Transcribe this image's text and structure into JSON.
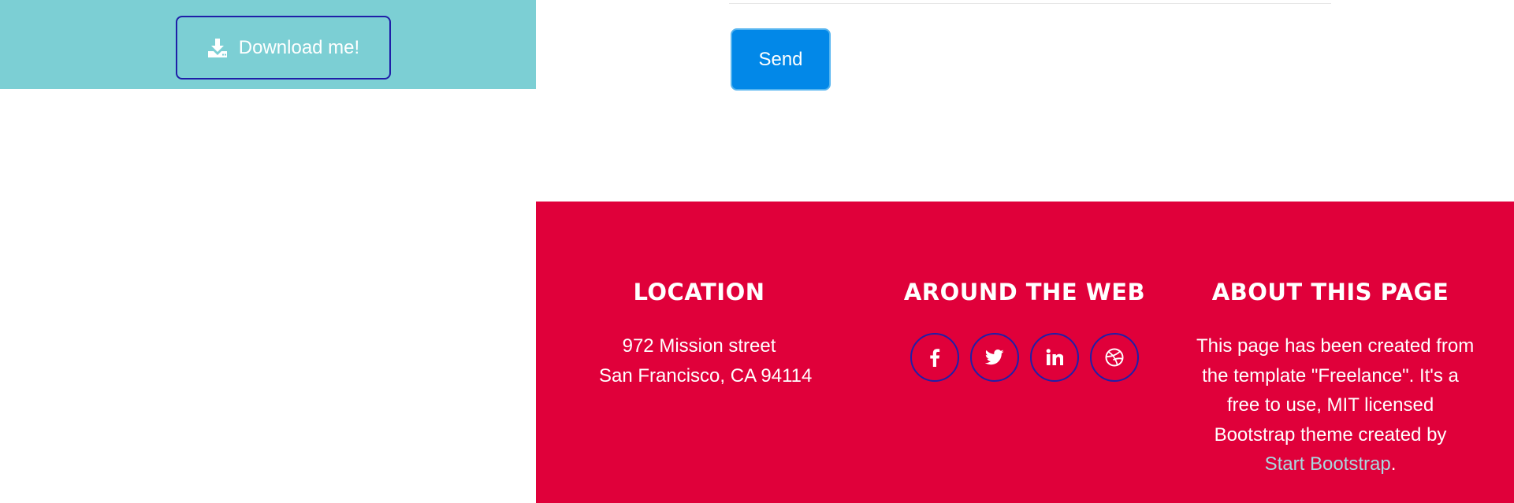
{
  "download": {
    "label": "Download me!",
    "icon": "download-icon"
  },
  "form": {
    "send_label": "Send"
  },
  "footer": {
    "location": {
      "heading": "LOCATION",
      "address_line1": "972 Mission street",
      "address_line2": "San Francisco, CA 94114"
    },
    "web": {
      "heading": "AROUND THE WEB",
      "social": [
        {
          "name": "facebook-icon"
        },
        {
          "name": "twitter-icon"
        },
        {
          "name": "linkedin-icon"
        },
        {
          "name": "dribbble-icon"
        }
      ]
    },
    "about": {
      "heading": "ABOUT THIS PAGE",
      "line1": "This page has been created from",
      "line2": "the template \"Freelance\". It's a",
      "line3": "free to use, MIT licensed",
      "line4": "Bootstrap theme created by",
      "link_text": "Start Bootstrap",
      "trailing": "."
    }
  },
  "colors": {
    "download_band": "#7ccfd4",
    "button_border": "#1f1fa8",
    "send_button": "#0288e8",
    "footer_bg": "#e0003a",
    "link": "#a8d8e0"
  }
}
